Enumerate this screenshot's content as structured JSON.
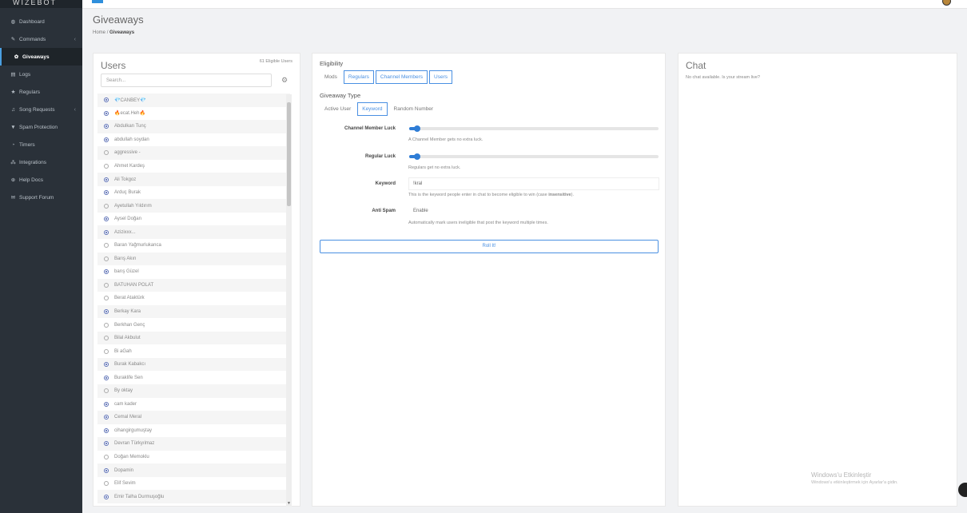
{
  "brand": "WIZEBOT",
  "sidebar": {
    "items": [
      {
        "icon": "dashboard-icon",
        "glyph": "◍",
        "label": "Dashboard",
        "chevron": false,
        "active": false
      },
      {
        "icon": "wrench-icon",
        "glyph": "✎",
        "label": "Commands",
        "chevron": true,
        "active": false
      },
      {
        "icon": "gift-icon",
        "glyph": "✿",
        "label": "Giveaways",
        "chevron": false,
        "active": true
      },
      {
        "icon": "logs-icon",
        "glyph": "▤",
        "label": "Logs",
        "chevron": false,
        "active": false
      },
      {
        "icon": "star-icon",
        "glyph": "★",
        "label": "Regulars",
        "chevron": false,
        "active": false
      },
      {
        "icon": "music-icon",
        "glyph": "♫",
        "label": "Song Requests",
        "chevron": true,
        "active": false
      },
      {
        "icon": "filter-icon",
        "glyph": "▼",
        "label": "Spam Protection",
        "chevron": false,
        "active": false
      },
      {
        "icon": "clock-icon",
        "glyph": "◔",
        "label": "Timers",
        "chevron": false,
        "active": false
      },
      {
        "icon": "integrations-icon",
        "glyph": "⁂",
        "label": "Integrations",
        "chevron": false,
        "active": false
      },
      {
        "icon": "globe-icon",
        "glyph": "⊕",
        "label": "Help Docs",
        "chevron": false,
        "active": false
      },
      {
        "icon": "chat-icon",
        "glyph": "✉",
        "label": "Support Forum",
        "chevron": false,
        "active": false
      }
    ]
  },
  "header": {
    "title": "Giveaways",
    "breadcrumb_home": "Home",
    "breadcrumb_sep": "/",
    "breadcrumb_current": "Giveaways"
  },
  "users": {
    "title": "Users",
    "eligible_text": "61 Eligible Users",
    "search_placeholder": "Search...",
    "list": [
      {
        "name": "💎CANBEY💎",
        "checked": true
      },
      {
        "name": "🔥ecat.Heh🔥",
        "checked": true
      },
      {
        "name": "Abdulkan Tunç",
        "checked": true
      },
      {
        "name": "abdullah soydan",
        "checked": true
      },
      {
        "name": "aggressive -",
        "checked": false
      },
      {
        "name": "Ahmet Kardeş",
        "checked": false
      },
      {
        "name": "Ali Tokgoz",
        "checked": true
      },
      {
        "name": "Arduç Burak",
        "checked": true
      },
      {
        "name": "Ayetullah Yıldırım",
        "checked": false
      },
      {
        "name": "Aysel Doğan",
        "checked": true
      },
      {
        "name": "Azizixxx...",
        "checked": true
      },
      {
        "name": "Baran Yağmurlukanca",
        "checked": false
      },
      {
        "name": "Barış Akın",
        "checked": false
      },
      {
        "name": "barış Güzel",
        "checked": true
      },
      {
        "name": "BATUHAN POLAT",
        "checked": false
      },
      {
        "name": "Berat Ataktürk",
        "checked": false
      },
      {
        "name": "Berkay Kara",
        "checked": true
      },
      {
        "name": "Berkhan Genç",
        "checked": false
      },
      {
        "name": "Bilal Akbulut",
        "checked": false
      },
      {
        "name": "Bi aGah",
        "checked": false
      },
      {
        "name": "Burak Kabakcı",
        "checked": true
      },
      {
        "name": "Buraklife Sen",
        "checked": true
      },
      {
        "name": "By oktay",
        "checked": false
      },
      {
        "name": "cam kader",
        "checked": true
      },
      {
        "name": "Cemal Meral",
        "checked": true
      },
      {
        "name": "cihangirgumuştay",
        "checked": true
      },
      {
        "name": "Devran Türkyılmaz",
        "checked": true
      },
      {
        "name": "Doğan Memoklu",
        "checked": false
      },
      {
        "name": "Dopamin",
        "checked": true
      },
      {
        "name": "Elif Sevim",
        "checked": false
      },
      {
        "name": "Emir Talha Durmuşoğlu",
        "checked": true
      }
    ]
  },
  "config": {
    "eligibility": {
      "title": "Eligibility",
      "options": [
        "Mods",
        "Regulars",
        "Channel Members",
        "Users"
      ],
      "selected": [
        "Regulars",
        "Channel Members",
        "Users"
      ]
    },
    "type": {
      "title": "Giveaway Type",
      "options": [
        "Active User",
        "Keyword",
        "Random Number"
      ],
      "selected": [
        "Keyword"
      ]
    },
    "channel_luck": {
      "label": "Channel Member Luck",
      "value": 0.02,
      "help": "A Channel Member gets no extra luck."
    },
    "regular_luck": {
      "label": "Regular Luck",
      "value": 0.02,
      "help": "Regulars get no extra luck."
    },
    "keyword": {
      "label": "Keyword",
      "value": "!kral",
      "help_pre": "This is the keyword people enter in chat to become eligible to win (case ",
      "help_bold": "insensitive",
      "help_post": ")."
    },
    "anti_spam": {
      "label": "Anti Spam",
      "value": "Enable",
      "help": "Automatically mark users ineligible that post the keyword multiple times."
    },
    "roll_label": "Roll It!"
  },
  "chat": {
    "title": "Chat",
    "empty_text": "No chat available. Is your stream live?"
  },
  "watermark": {
    "line1": "Windows'u Etkinleştir",
    "line2": "Windows'u etkinleştirmek için Ayarlar'a gidin."
  },
  "colors": {
    "sidebar": "#2a3139",
    "accent": "#2f7dd6"
  }
}
